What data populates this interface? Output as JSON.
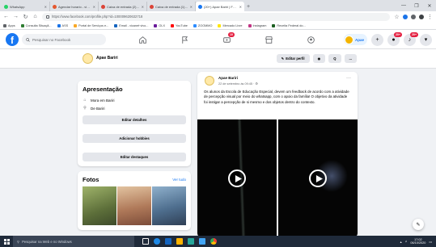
{
  "browser": {
    "tabs": [
      {
        "title": "WhatsApp",
        "color": "#25d366",
        "active": false
      },
      {
        "title": "Agendar horario - vicanoweb",
        "color": "#e4572e",
        "active": false
      },
      {
        "title": "Caixa de entrada (2) - ascbru",
        "color": "#db4437",
        "active": false
      },
      {
        "title": "Caixa de entrada (1) - apae@",
        "color": "#db4437",
        "active": false
      },
      {
        "title": "(20+) Apae Bariri | Facebook",
        "color": "#1877f2",
        "active": true
      }
    ],
    "new_tab": "+",
    "window_controls": [
      "—",
      "❐",
      "✕"
    ],
    "url": "https://www.facebook.com/profile.php?id=100009620632718",
    "bookmarks": [
      {
        "label": "Apps",
        "color": "#5f6368"
      },
      {
        "label": "Consulta Situaçã...",
        "color": "#2e7d32"
      },
      {
        "label": "ASS",
        "color": "#1a73e8"
      },
      {
        "label": "Portal de Serviços e...",
        "color": "#f9a825"
      },
      {
        "label": "Email - vicanet·vivo...",
        "color": "#1565c0"
      },
      {
        "label": "OLX",
        "color": "#6a1b9a"
      },
      {
        "label": "YouTube",
        "color": "#ff0000"
      },
      {
        "label": "ZOOMMO",
        "color": "#2d8cff"
      },
      {
        "label": "Mercado Livre",
        "color": "#ffe600"
      },
      {
        "label": "Instagram",
        "color": "#c13584"
      },
      {
        "label": "Receita Federal do...",
        "color": "#1b5e20"
      }
    ]
  },
  "facebook": {
    "search_placeholder": "Pesquisar no Facebook",
    "nav_badge": "10",
    "profile_chip": "Apae",
    "badges": {
      "messenger": "20+",
      "notifications": "20+"
    }
  },
  "page": {
    "name": "Apae Bariri",
    "edit_profile": "Editar perfil",
    "more_btn": "...",
    "search_btn": "Q",
    "eye_btn": "◉"
  },
  "intro": {
    "title": "Apresentação",
    "lives_in": "Mora em Bariri",
    "from": "De Bariri",
    "edit_details": "Editar detalhes",
    "add_hobbies": "Adicionar hobbies",
    "edit_featured": "Editar destaques"
  },
  "photos": {
    "title": "Fotos",
    "see_all": "Ver tudo",
    "colors": [
      "#7a8c4a",
      "#c9a07a",
      "#4f6f8f"
    ]
  },
  "post": {
    "author": "Apae Bariri",
    "date": "22 de setembro às 09:45 · ⚙",
    "text": "Os alunos da Escola de Educação Especial, devem um feedback de acordo com a atividade de percepção visual por meio do whatsapp, com o apoio da família! O objetivo da atividade foi instigar a percepção de si mesmo e dos objetos dentro do contexto.",
    "more": "···"
  },
  "taskbar": {
    "search_placeholder": "Pesquisar na Web e no Windows",
    "time": "17:02",
    "date": "06/10/2020",
    "app_colors": [
      "#f5f5f5",
      "#1e88e5",
      "#1565c0",
      "#ffb300",
      "#26a69a",
      "#42a5f5",
      "#ff7043"
    ]
  }
}
